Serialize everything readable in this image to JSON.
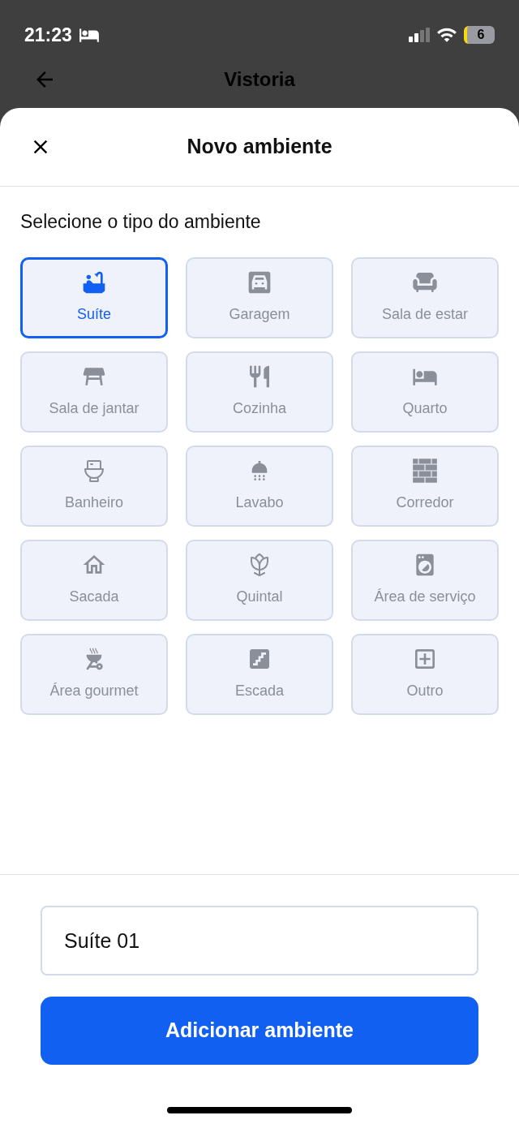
{
  "status_bar": {
    "time": "21:23",
    "battery": "6"
  },
  "nav": {
    "title": "Vistoria"
  },
  "sheet": {
    "title": "Novo ambiente",
    "section_label": "Selecione o tipo do ambiente",
    "types": [
      {
        "label": "Suíte",
        "kind": "bathtub",
        "selected": true
      },
      {
        "label": "Garagem",
        "kind": "garage",
        "selected": false
      },
      {
        "label": "Sala de estar",
        "kind": "armchair",
        "selected": false
      },
      {
        "label": "Sala de jantar",
        "kind": "table",
        "selected": false
      },
      {
        "label": "Cozinha",
        "kind": "cutlery",
        "selected": false
      },
      {
        "label": "Quarto",
        "kind": "bed",
        "selected": false
      },
      {
        "label": "Banheiro",
        "kind": "toilet",
        "selected": false
      },
      {
        "label": "Lavabo",
        "kind": "shower",
        "selected": false
      },
      {
        "label": "Corredor",
        "kind": "bricks",
        "selected": false
      },
      {
        "label": "Sacada",
        "kind": "house",
        "selected": false
      },
      {
        "label": "Quintal",
        "kind": "flower",
        "selected": false
      },
      {
        "label": "Área de serviço",
        "kind": "washer",
        "selected": false
      },
      {
        "label": "Área gourmet",
        "kind": "grill",
        "selected": false
      },
      {
        "label": "Escada",
        "kind": "stairs",
        "selected": false
      },
      {
        "label": "Outro",
        "kind": "add",
        "selected": false
      }
    ],
    "name_field": {
      "value": "Suíte 01"
    },
    "submit": "Adicionar ambiente"
  }
}
